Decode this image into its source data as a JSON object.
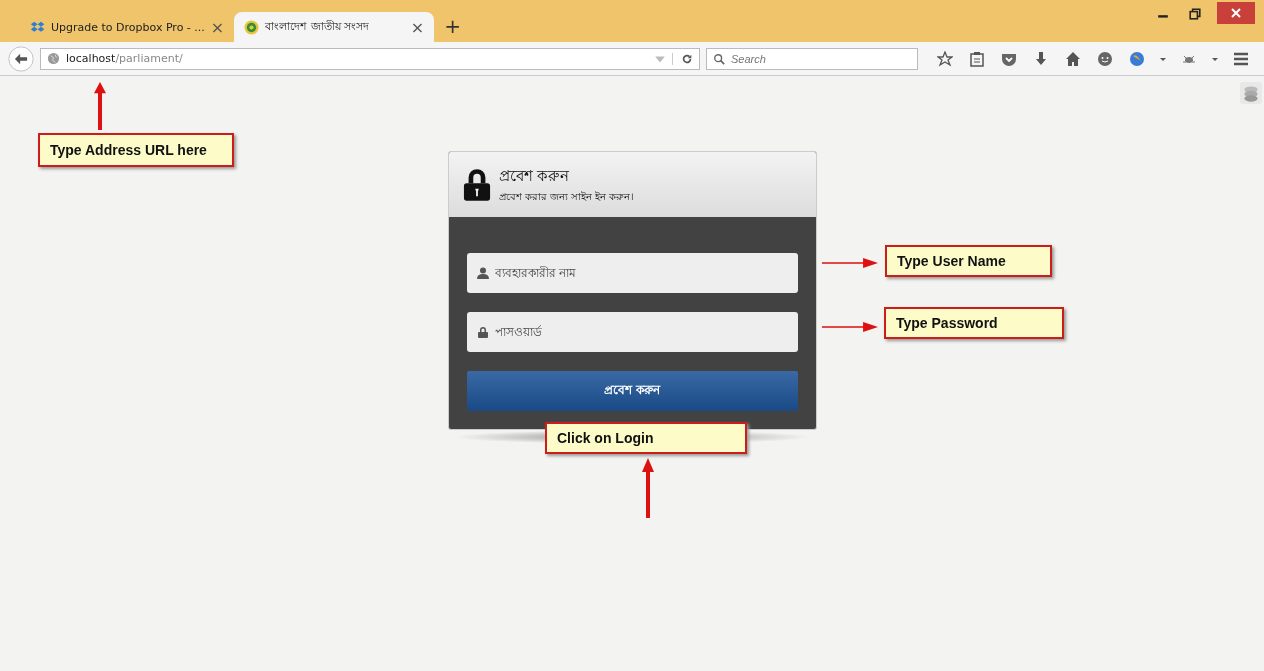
{
  "tabs": [
    {
      "title": "Upgrade to Dropbox Pro - ...",
      "close": "×",
      "selected": false
    },
    {
      "title": "বাংলাদেশ জাতীয় সংসদ",
      "close": "×",
      "selected": true
    }
  ],
  "new_tab": "+",
  "address_bar": {
    "host": "localhost",
    "path": "/parliament/"
  },
  "search": {
    "placeholder": "Search"
  },
  "login": {
    "title": "প্রবেশ করুন",
    "subtitle": "প্রবেশ করার জন্য সাইন ইন করুন।",
    "username_placeholder": "ব্যবহারকারীর নাম",
    "password_placeholder": "পাসওয়ার্ড",
    "button": "প্রবেশ করুন"
  },
  "callouts": [
    {
      "kind": "address",
      "text": "Type Address URL here"
    },
    {
      "kind": "username",
      "text": "Type User Name"
    },
    {
      "kind": "password",
      "text": "Type Password"
    },
    {
      "kind": "login",
      "text": "Click on Login"
    }
  ]
}
